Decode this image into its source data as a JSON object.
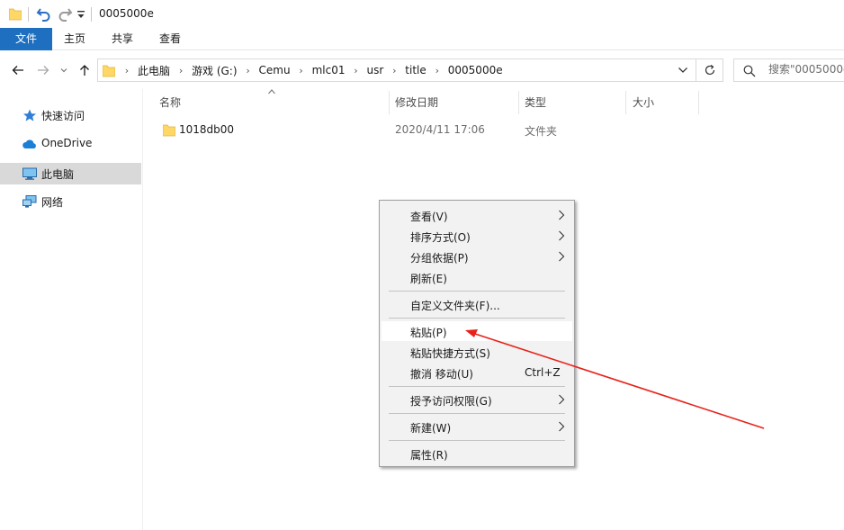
{
  "window": {
    "title": "0005000e"
  },
  "ribbon": {
    "tabs": [
      "文件",
      "主页",
      "共享",
      "查看"
    ]
  },
  "address": {
    "crumbs": [
      "此电脑",
      "游戏 (G:)",
      "Cemu",
      "mlc01",
      "usr",
      "title",
      "0005000e"
    ]
  },
  "search": {
    "placeholder": "搜索\"0005000e\""
  },
  "sidebar": {
    "items": [
      {
        "label": "快速访问",
        "icon": "star-icon"
      },
      {
        "label": "OneDrive",
        "icon": "cloud-icon"
      },
      {
        "label": "此电脑",
        "icon": "computer-icon",
        "selected": true
      },
      {
        "label": "网络",
        "icon": "network-icon"
      }
    ]
  },
  "columns": {
    "name": "名称",
    "date": "修改日期",
    "type": "类型",
    "size": "大小"
  },
  "files": [
    {
      "name": "1018db00",
      "date": "2020/4/11 17:06",
      "type": "文件夹",
      "icon": "folder-icon"
    }
  ],
  "context_menu": {
    "items": [
      {
        "label": "查看(V)",
        "submenu": true
      },
      {
        "label": "排序方式(O)",
        "submenu": true
      },
      {
        "label": "分组依据(P)",
        "submenu": true
      },
      {
        "label": "刷新(E)"
      },
      {
        "label": "自定义文件夹(F)..."
      },
      {
        "label": "粘贴(P)",
        "highlighted": true
      },
      {
        "label": "粘贴快捷方式(S)"
      },
      {
        "label": "撤消 移动(U)",
        "shortcut": "Ctrl+Z"
      },
      {
        "label": "授予访问权限(G)",
        "submenu": true
      },
      {
        "label": "新建(W)",
        "submenu": true
      },
      {
        "label": "属性(R)"
      }
    ]
  },
  "colors": {
    "accent": "#1e6fbf",
    "annotation_arrow": "#e8221a",
    "folder": "#ffd766"
  }
}
